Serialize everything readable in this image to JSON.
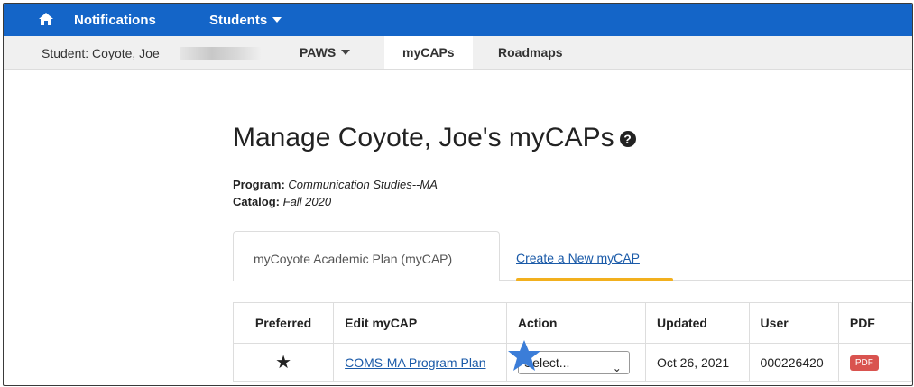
{
  "topnav": {
    "home_icon": "home-icon",
    "notifications": "Notifications",
    "students": "Students"
  },
  "subnav": {
    "student": "Student: Coyote, Joe",
    "tabs": [
      "PAWS",
      "myCAPs",
      "Roadmaps"
    ]
  },
  "page": {
    "title": "Manage Coyote, Joe's myCAPs",
    "program_label": "Program:",
    "program_value": "Communication Studies--MA",
    "catalog_label": "Catalog:",
    "catalog_value": "Fall 2020"
  },
  "tabs": {
    "active": "myCoyote Academic Plan (myCAP)",
    "create": "Create a New myCAP"
  },
  "table": {
    "headers": [
      "Preferred",
      "Edit myCAP",
      "Action",
      "Updated",
      "User",
      "PDF"
    ],
    "row": {
      "plan_link": "COMS-MA Program Plan",
      "action_value": "Select...",
      "updated": "Oct 26, 2021",
      "user": "000226420",
      "pdf": "PDF"
    }
  },
  "colors": {
    "navbar": "#1465c8",
    "highlight": "#f2b01e",
    "pdf_badge": "#d9534f",
    "star_annotation": "#3b7dd8"
  }
}
